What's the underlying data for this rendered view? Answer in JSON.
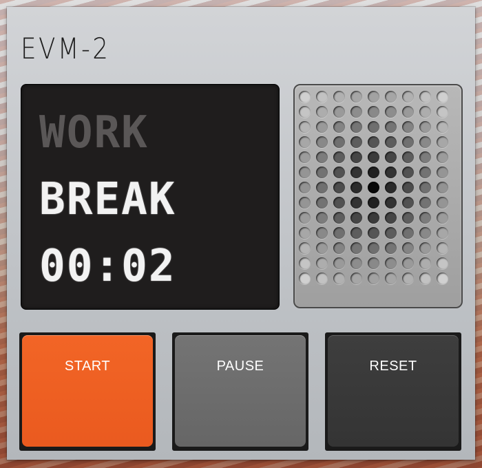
{
  "app": {
    "title": "EVM-2"
  },
  "display": {
    "mode_work": "WORK",
    "mode_break": "BREAK",
    "active_mode": "BREAK",
    "time": "00:02"
  },
  "controls": {
    "start_label": "START",
    "pause_label": "PAUSE",
    "reset_label": "RESET"
  },
  "colors": {
    "start": "#f26526",
    "pause": "#6e6e6e",
    "reset": "#383838",
    "screen": "#1f1d1d",
    "segment_lit": "#f2f2f2",
    "segment_dim": "#5a5757"
  },
  "speaker": {
    "rows": 13,
    "cols": 9,
    "icon": "speaker-grille"
  }
}
